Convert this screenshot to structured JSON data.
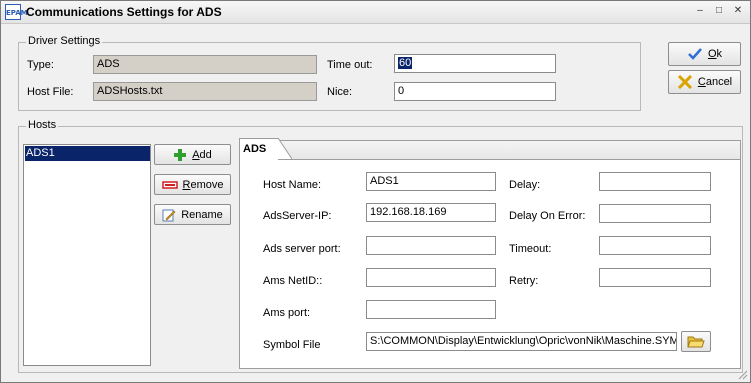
{
  "window": {
    "app_icon": "EPAM",
    "title": "Communications Settings for ADS",
    "controls": {
      "minimize": "–",
      "maximize": "□",
      "close": "✕"
    }
  },
  "driver_settings": {
    "legend": "Driver Settings",
    "type_label": "Type:",
    "type_value": "ADS",
    "host_file_label": "Host File:",
    "host_file_value": "ADSHosts.txt",
    "timeout_label": "Time out:",
    "timeout_value": "60",
    "nice_label": "Nice:",
    "nice_value": "0"
  },
  "buttons": {
    "ok_first": "O",
    "ok_rest": "k",
    "cancel_first": "C",
    "cancel_rest": "ancel"
  },
  "hosts": {
    "legend": "Hosts",
    "items": [
      "ADS1"
    ],
    "add_first": "A",
    "add_rest": "dd",
    "remove_first": "R",
    "remove_rest": "emove",
    "rename_label": "Rename"
  },
  "tab": {
    "label": "ADS",
    "host_name_label": "Host Name:",
    "host_name_value": "ADS1",
    "ads_server_ip_label": "AdsServer-IP:",
    "ads_server_ip_value": "192.168.18.169",
    "ads_server_port_label": "Ads server port:",
    "ads_server_port_value": "",
    "ams_netid_label": "Ams NetID::",
    "ams_netid_value": "",
    "ams_port_label": "Ams port:",
    "ams_port_value": "",
    "symbol_file_label": "Symbol File",
    "symbol_file_value": "S:\\COMMON\\Display\\Entwicklung\\Opric\\vonNik\\Maschine.SYM",
    "delay_label": "Delay:",
    "delay_value": "",
    "delay_on_error_label": "Delay On Error:",
    "delay_on_error_value": "",
    "timeout_label": "Timeout:",
    "timeout_value": "",
    "retry_label": "Retry:",
    "retry_value": ""
  },
  "colors": {
    "selection": "#0a246a",
    "readonly_field": "#d4d0c8",
    "ok_check": "#2f6fd6",
    "cancel_x": "#d9a400",
    "add_plus": "#2ea02e",
    "remove_bar": "#d02020"
  },
  "icons": [
    "app-icon",
    "check-icon",
    "cancel-x-icon",
    "plus-icon",
    "remove-icon",
    "rename-icon",
    "folder-open-icon"
  ]
}
